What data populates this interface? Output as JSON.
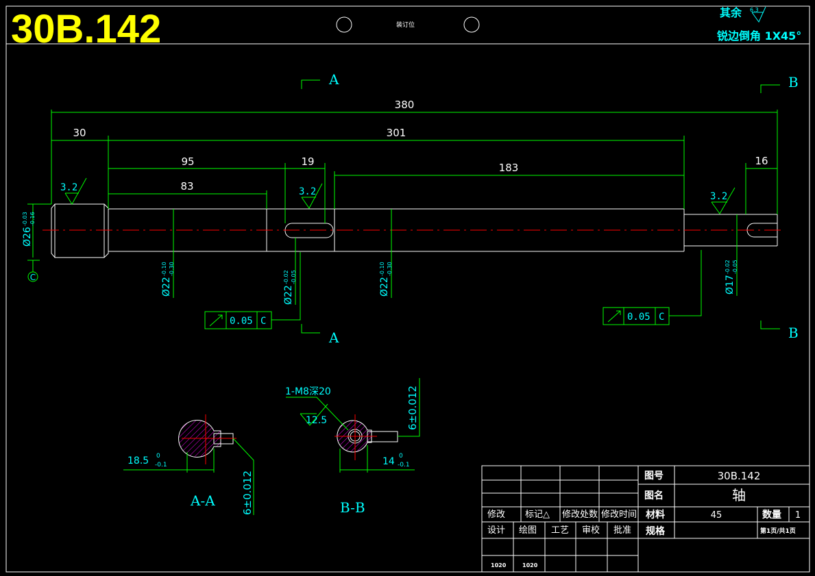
{
  "header": {
    "drawing_no_big": "30B.142",
    "binding_label": "装订位",
    "roughness_note_prefix": "其余",
    "roughness_note_value": "6.3",
    "chamfer_note": "锐边倒角 1X45°"
  },
  "sections": {
    "a_upper": "A",
    "a_lower": "A",
    "b_upper": "B",
    "b_lower": "B",
    "view_aa": "A-A",
    "view_bb": "B-B"
  },
  "dimensions": {
    "overall": "380",
    "left_step": "30",
    "middle": "301",
    "d95": "95",
    "d19": "19",
    "d183": "183",
    "d16": "16",
    "d83": "83",
    "dia26": "Ø26",
    "dia26_up": "-0.03",
    "dia26_lo": "-0.16",
    "dia22a": "Ø22",
    "dia22a_up": "-0.10",
    "dia22a_lo": "-0.30",
    "dia22b": "Ø22",
    "dia22b_up": "-0.02",
    "dia22b_lo": "-0.05",
    "dia22c": "Ø22",
    "dia22c_up": "-0.10",
    "dia22c_lo": "-0.30",
    "dia17": "Ø17",
    "dia17_up": "-0.02",
    "dia17_lo": "-0.05",
    "rough_left": "3.2",
    "rough_mid": "3.2",
    "rough_right": "3.2",
    "datum": "C",
    "sec_a_width": "18.5",
    "sec_a_width_up": "0",
    "sec_a_width_lo": "-0.1",
    "sec_a_key": "6±0.012",
    "sec_b_width": "14",
    "sec_b_width_up": "0",
    "sec_b_width_lo": "-0.1",
    "sec_b_key": "6±0.012",
    "thread_note": "1-M8深20",
    "thread_rough": "12.5"
  },
  "tolerance_frames": [
    {
      "value": "0.05",
      "datum": "C"
    },
    {
      "value": "0.05",
      "datum": "C"
    }
  ],
  "title_block": {
    "label_drawing_no": "图号",
    "drawing_no": "30B.142",
    "label_name": "图名",
    "name": "轴",
    "label_material": "材料",
    "material": "45",
    "label_qty": "数量",
    "qty": "1",
    "label_spec": "规格",
    "sheet": "第1页/共1页",
    "rev_headers": [
      "修改",
      "标记△",
      "修改处数",
      "修改时间"
    ],
    "sign_headers": [
      "设计",
      "绘图",
      "工艺",
      "审校",
      "批准"
    ],
    "sign_values": [
      "1020",
      "1020"
    ]
  }
}
